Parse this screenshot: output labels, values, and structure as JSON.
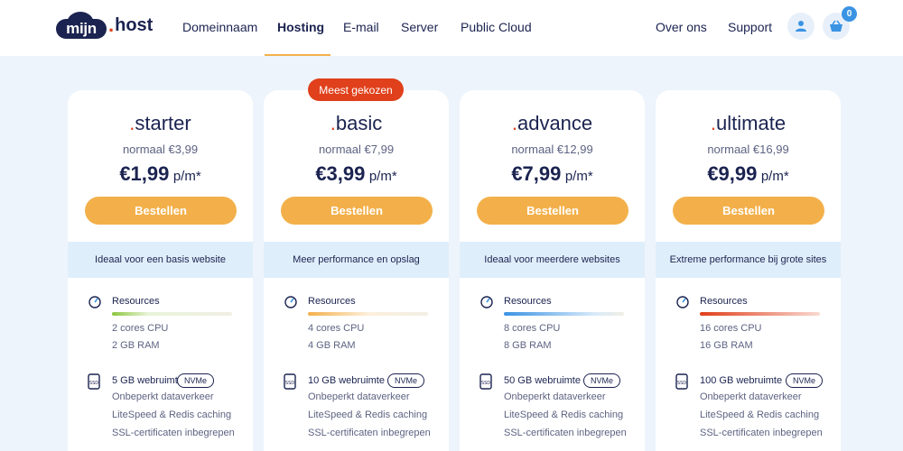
{
  "header": {
    "logo": {
      "mark_text": "mijn",
      "dot": ".",
      "suffix": "host"
    },
    "nav": [
      "Domeinnaam",
      "Hosting",
      "E-mail",
      "Server",
      "Public Cloud"
    ],
    "nav_active": "Hosting",
    "right_links": [
      "Over ons",
      "Support"
    ],
    "account_icon": "user-icon",
    "cart_icon": "basket-icon",
    "cart_count": "0"
  },
  "colors": {
    "brand_navy": "#1b2350",
    "accent_orange": "#f3b04a",
    "accent_red": "#e0401b",
    "tag_blue": "#dfeefb",
    "badge_blue": "#3a93e3"
  },
  "plans": [
    {
      "dot": ".",
      "name": "starter",
      "normal_price": "normaal €3,99",
      "price": "€1,99",
      "period": "p/m*",
      "button": "Bestellen",
      "tagline": "Ideaal voor een basis website",
      "resources_label": "Resources",
      "cpu": "2 cores CPU",
      "ram": "2 GB RAM",
      "resource_level": 0.25,
      "resource_color": "#8cc63f",
      "storage": "5 GB webruimte",
      "storage_badge": "NVMe",
      "features": [
        "Onbeperkt dataverkeer",
        "LiteSpeed & Redis caching",
        "SSL-certificaten inbegrepen"
      ]
    },
    {
      "dot": ".",
      "name": "basic",
      "normal_price": "normaal €7,99",
      "price": "€3,99",
      "period": "p/m*",
      "button": "Bestellen",
      "tagline": "Meer performance en opslag",
      "resources_label": "Resources",
      "cpu": "4 cores CPU",
      "ram": "4 GB RAM",
      "resource_level": 0.5,
      "resource_color": "#f3b04a",
      "storage": "10 GB webruimte",
      "storage_badge": "NVMe",
      "features": [
        "Onbeperkt dataverkeer",
        "LiteSpeed & Redis caching",
        "SSL-certificaten inbegrepen"
      ],
      "badge": "Meest gekozen"
    },
    {
      "dot": ".",
      "name": "advance",
      "normal_price": "normaal €12,99",
      "price": "€7,99",
      "period": "p/m*",
      "button": "Bestellen",
      "tagline": "Ideaal voor meerdere websites",
      "resources_label": "Resources",
      "cpu": "8 cores CPU",
      "ram": "8 GB RAM",
      "resource_level": 0.75,
      "resource_color": "#3a93e3",
      "storage": "50 GB webruimte",
      "storage_badge": "NVMe",
      "features": [
        "Onbeperkt dataverkeer",
        "LiteSpeed & Redis caching",
        "SSL-certificaten inbegrepen"
      ]
    },
    {
      "dot": ".",
      "name": "ultimate",
      "normal_price": "normaal €16,99",
      "price": "€9,99",
      "period": "p/m*",
      "button": "Bestellen",
      "tagline": "Extreme performance bij grote sites",
      "resources_label": "Resources",
      "cpu": "16 cores CPU",
      "ram": "16 GB RAM",
      "resource_level": 1.0,
      "resource_color": "#e0401b",
      "storage": "100 GB webruimte",
      "storage_badge": "NVMe",
      "features": [
        "Onbeperkt dataverkeer",
        "LiteSpeed & Redis caching",
        "SSL-certificaten inbegrepen"
      ]
    }
  ]
}
